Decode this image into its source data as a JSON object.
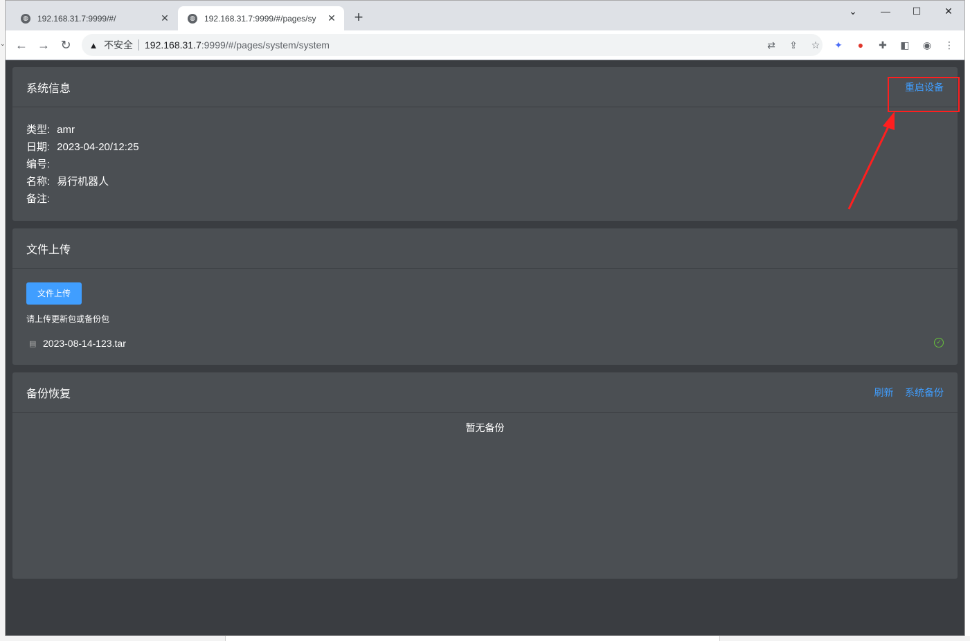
{
  "browser": {
    "tabs": [
      {
        "title": "192.168.31.7:9999/#/",
        "active": false
      },
      {
        "title": "192.168.31.7:9999/#/pages/sy",
        "active": true
      }
    ],
    "insecure_label": "不安全",
    "url_host": "192.168.31.7",
    "url_path": ":9999/#/pages/system/system",
    "window_controls": [
      "chevron-down-icon",
      "minimize-icon",
      "maximize-icon",
      "close-icon"
    ],
    "toolbar_icons": [
      "back-icon",
      "forward-icon",
      "reload-icon",
      "translate-icon",
      "share-icon",
      "star-icon",
      "extension-a-icon",
      "extension-b-icon",
      "puzzle-icon",
      "sidepanel-icon",
      "profile-icon",
      "menu-icon"
    ]
  },
  "system_info": {
    "title": "系统信息",
    "restart_label": "重启设备",
    "rows": [
      {
        "key": "类型:",
        "value": "amr"
      },
      {
        "key": "日期:",
        "value": "2023-04-20/12:25"
      },
      {
        "key": "编号:",
        "value": ""
      },
      {
        "key": "名称:",
        "value": "易行机器人"
      },
      {
        "key": "备注:",
        "value": ""
      }
    ]
  },
  "file_upload": {
    "title": "文件上传",
    "button_label": "文件上传",
    "tip": "请上传更新包或备份包",
    "file_name": "2023-08-14-123.tar"
  },
  "backup_restore": {
    "title": "备份恢复",
    "refresh_label": "刷新",
    "backup_label": "系统备份",
    "empty_text": "暂无备份"
  },
  "colors": {
    "page_bg": "#3a3d41",
    "card_bg": "#4b4f53",
    "link": "#409eff",
    "primary": "#409eff",
    "success": "#67c23a",
    "annotation": "#ff1f1f"
  }
}
